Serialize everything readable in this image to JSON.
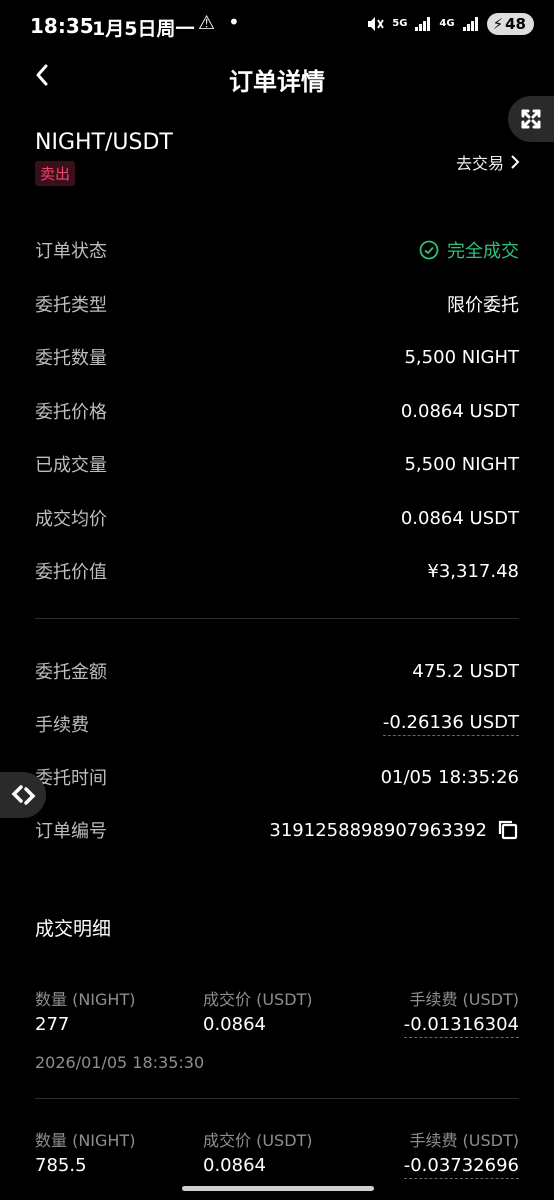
{
  "status_bar": {
    "time": "18:35",
    "date": "1月5日周一",
    "net1": "5G",
    "net2": "4G",
    "battery": "48"
  },
  "header": {
    "title": "订单详情"
  },
  "order": {
    "pair": "NIGHT/USDT",
    "side": "卖出",
    "goto_trade": "去交易",
    "rows": [
      {
        "label": "订单状态",
        "value": "完全成交"
      },
      {
        "label": "委托类型",
        "value": "限价委托"
      },
      {
        "label": "委托数量",
        "value": "5,500 NIGHT"
      },
      {
        "label": "委托价格",
        "value": "0.0864 USDT"
      },
      {
        "label": "已成交量",
        "value": "5,500 NIGHT"
      },
      {
        "label": "成交均价",
        "value": "0.0864 USDT"
      },
      {
        "label": "委托价值",
        "value": "¥3,317.48"
      }
    ],
    "rows2": [
      {
        "label": "委托金额",
        "value": "475.2 USDT"
      },
      {
        "label": "手续费",
        "value": "-0.26136 USDT"
      },
      {
        "label": "委托时间",
        "value": "01/05 18:35:26"
      },
      {
        "label": "订单编号",
        "value": "3191258898907963392"
      }
    ]
  },
  "fills": {
    "title": "成交明细",
    "headers": {
      "qty": "数量 (NIGHT)",
      "price": "成交价 (USDT)",
      "fee": "手续费 (USDT)"
    },
    "items": [
      {
        "qty": "277",
        "price": "0.0864",
        "fee": "-0.01316304",
        "time": "2026/01/05 18:35:30"
      },
      {
        "qty": "785.5",
        "price": "0.0864",
        "fee": "-0.03732696"
      }
    ]
  },
  "colors": {
    "success": "#2fc077",
    "sell": "#f0456a",
    "background": "#000000"
  }
}
